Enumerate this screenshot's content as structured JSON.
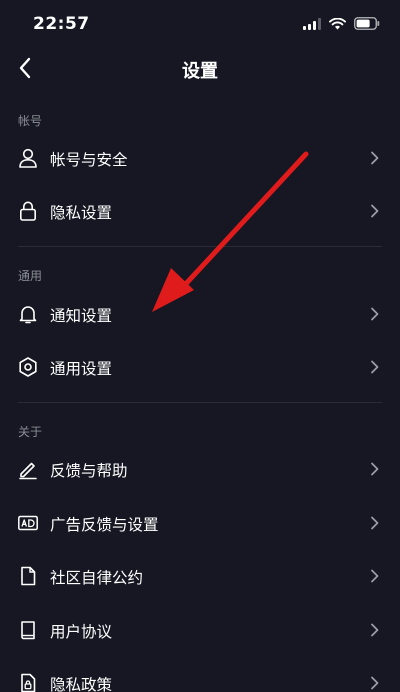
{
  "status_bar": {
    "time": "22:57",
    "signal_icon": "signal-bars-icon",
    "wifi_icon": "wifi-icon",
    "battery_icon": "battery-icon"
  },
  "nav": {
    "title": "设置",
    "back_icon": "chevron-left-icon"
  },
  "sections": [
    {
      "label": "帐号",
      "items": [
        {
          "label": "帐号与安全",
          "icon": "person-icon"
        },
        {
          "label": "隐私设置",
          "icon": "lock-icon"
        }
      ]
    },
    {
      "label": "通用",
      "items": [
        {
          "label": "通知设置",
          "icon": "bell-icon"
        },
        {
          "label": "通用设置",
          "icon": "gear-icon"
        }
      ]
    },
    {
      "label": "关于",
      "items": [
        {
          "label": "反馈与帮助",
          "icon": "pencil-icon"
        },
        {
          "label": "广告反馈与设置",
          "icon": "ad-icon"
        },
        {
          "label": "社区自律公约",
          "icon": "document-icon"
        },
        {
          "label": "用户协议",
          "icon": "book-icon"
        },
        {
          "label": "隐私政策",
          "icon": "document-lock-icon"
        }
      ]
    }
  ],
  "colors": {
    "background": "#161722",
    "annotation_arrow": "#e01b1b",
    "secondary_text": "#8a8c97"
  }
}
